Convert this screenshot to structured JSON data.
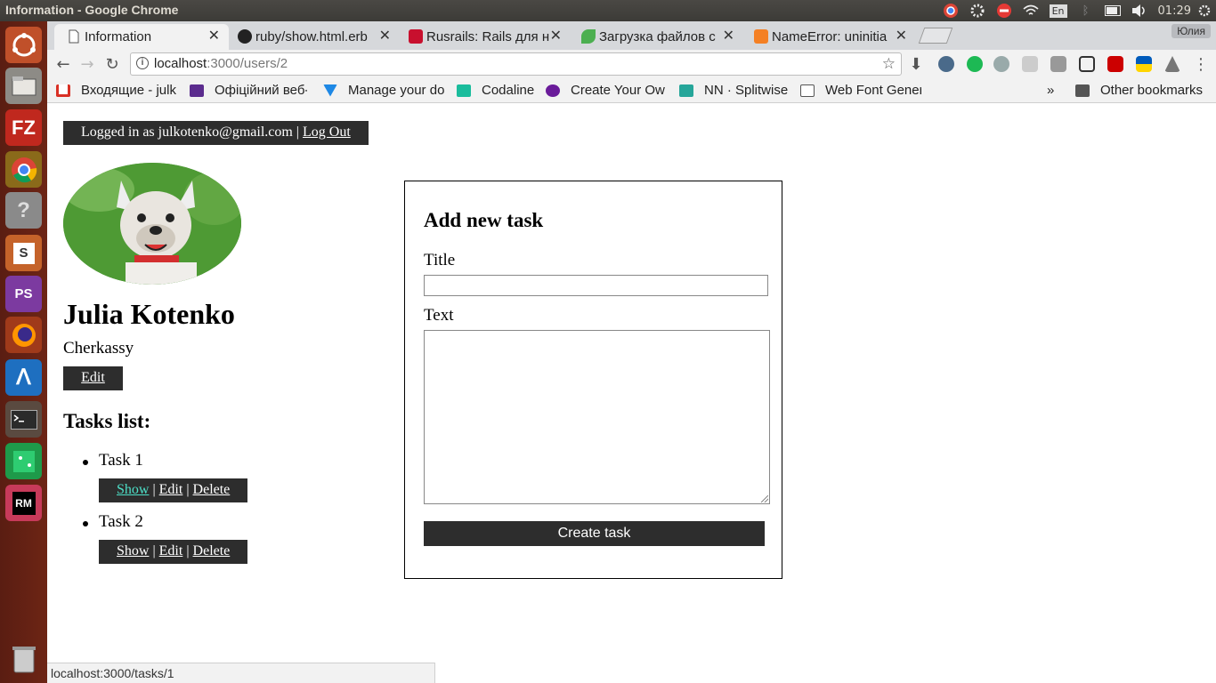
{
  "os": {
    "window_title": "Information - Google Chrome",
    "tray_lang": "En",
    "clock": "01:29"
  },
  "launcher": {
    "items": [
      "ubuntu-icon",
      "files-icon",
      "filezilla-icon",
      "chrome-icon",
      "help-icon",
      "sublime-icon",
      "phpstorm-icon",
      "firefox-icon",
      "bluegriffon-icon",
      "terminal-icon",
      "green-app-icon",
      "rubymine-icon",
      "trash-icon"
    ],
    "labels": {
      "filezilla": "FZ",
      "sublime": "S",
      "phpstorm": "PS",
      "rubymine": "RM"
    }
  },
  "browser": {
    "tabs": [
      {
        "title": "Information",
        "icon_color": "#ffffff"
      },
      {
        "title": "ruby/show.html.erb",
        "icon_color": "#222222"
      },
      {
        "title": "Rusrails: Rails для н",
        "icon_color": "#c8102e"
      },
      {
        "title": "Загрузка файлов с",
        "icon_color": "#4caf50"
      },
      {
        "title": "NameError: uninitia",
        "icon_color": "#f48024"
      }
    ],
    "profile_name": "Юлия",
    "url_host": "localhost",
    "url_rest": ":3000/users/2",
    "bookmarks": [
      {
        "label": "Входящие - julk",
        "icon_color": "#d93025"
      },
      {
        "label": "Офіційний веб-",
        "icon_color": "#5b2c8e"
      },
      {
        "label": "Manage your do",
        "icon_color": "#1e88e5"
      },
      {
        "label": "Codaline",
        "icon_color": "#1abc9c"
      },
      {
        "label": "Create Your Ow",
        "icon_color": "#6a1b9a"
      },
      {
        "label": "NN · Splitwise",
        "icon_color": "#26a69a"
      },
      {
        "label": "Web Font Gener",
        "icon_color": "#ffffff"
      }
    ],
    "bookmarks_overflow": "»",
    "other_bookmarks": "Other bookmarks",
    "status_url": "localhost:3000/tasks/1"
  },
  "page": {
    "logged_in_text": "Logged in as julkotenko@gmail.com |",
    "logout_label": "Log Out",
    "user": {
      "name": "Julia Kotenko",
      "city": "Cherkassy",
      "edit_label": "Edit"
    },
    "tasks_heading": "Tasks list:",
    "tasks": [
      {
        "title": "Task 1",
        "show": "Show",
        "edit": "Edit",
        "delete": "Delete"
      },
      {
        "title": "Task 2",
        "show": "Show",
        "edit": "Edit",
        "delete": "Delete"
      }
    ],
    "form": {
      "heading": "Add new task",
      "title_label": "Title",
      "title_value": "",
      "text_label": "Text",
      "text_value": "",
      "submit_label": "Create task"
    }
  }
}
